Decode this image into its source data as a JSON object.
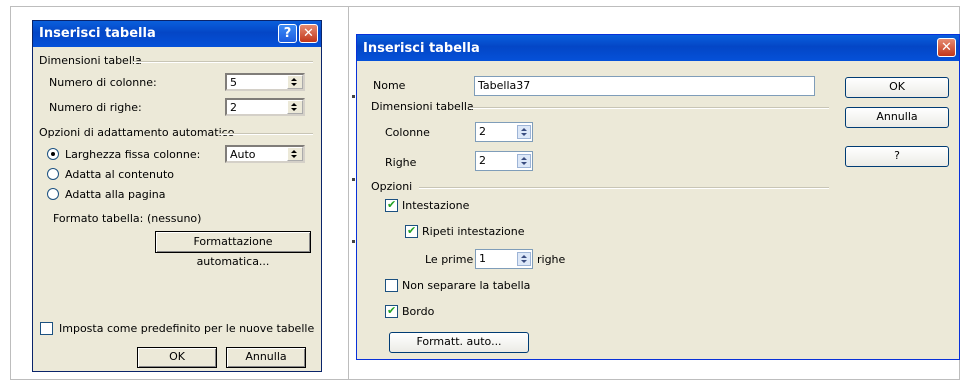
{
  "left_dialog": {
    "title": "Inserisci tabella",
    "help_label": "?",
    "close_label": "✕",
    "group_size": "Dimensioni tabella",
    "cols_label": "Numero di colonne:",
    "cols_value": "5",
    "rows_label": "Numero di righe:",
    "rows_value": "2",
    "group_autofit": "Opzioni di adattamento automatico",
    "radio_fixed": "Larghezza fissa colonne:",
    "fixed_value": "Auto",
    "radio_content": "Adatta al contenuto",
    "radio_window": "Adatta alla pagina",
    "format_label": "Formato tabella:",
    "format_value": "(nessuno)",
    "autoformat_button": "Formattazione automatica...",
    "default_checkbox": "Imposta come predefinito per le nuove tabelle",
    "ok_button": "OK",
    "cancel_button": "Annulla"
  },
  "right_dialog": {
    "title": "Inserisci tabella",
    "close_label": "✕",
    "name_label": "Nome",
    "name_value": "Tabella37",
    "group_size": "Dimensioni tabella",
    "cols_label": "Colonne",
    "cols_value": "2",
    "rows_label": "Righe",
    "rows_value": "2",
    "group_options": "Opzioni",
    "header_checkbox": "Intestazione",
    "repeat_checkbox": "Ripeti intestazione",
    "first_label": "Le prime",
    "first_value": "1",
    "first_unit": "righe",
    "nosplit_checkbox": "Non separare la tabella",
    "border_checkbox": "Bordo",
    "autoformat_button": "Formatt. auto...",
    "ok_button": "OK",
    "cancel_button": "Annulla",
    "help_button": "?"
  }
}
